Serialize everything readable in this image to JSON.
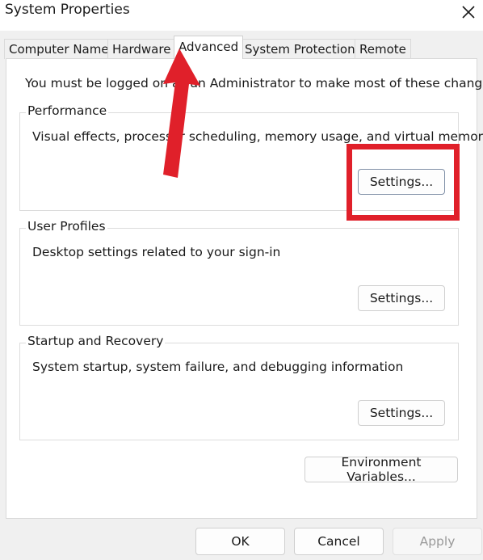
{
  "window": {
    "title": "System Properties"
  },
  "tabs": [
    {
      "label": "Computer Name",
      "active": false
    },
    {
      "label": "Hardware",
      "active": false
    },
    {
      "label": "Advanced",
      "active": true
    },
    {
      "label": "System Protection",
      "active": false
    },
    {
      "label": "Remote",
      "active": false
    }
  ],
  "advanced": {
    "intro": "You must be logged on as an Administrator to make most of these changes.",
    "performance": {
      "label": "Performance",
      "description": "Visual effects, processor scheduling, memory usage, and virtual memory",
      "button": "Settings..."
    },
    "user_profiles": {
      "label": "User Profiles",
      "description": "Desktop settings related to your sign-in",
      "button": "Settings..."
    },
    "startup_recovery": {
      "label": "Startup and Recovery",
      "description": "System startup, system failure, and debugging information",
      "button": "Settings..."
    },
    "environment_button": "Environment Variables..."
  },
  "footer": {
    "ok": "OK",
    "cancel": "Cancel",
    "apply": "Apply"
  },
  "annotations": {
    "highlight_color": "#e0202a"
  }
}
